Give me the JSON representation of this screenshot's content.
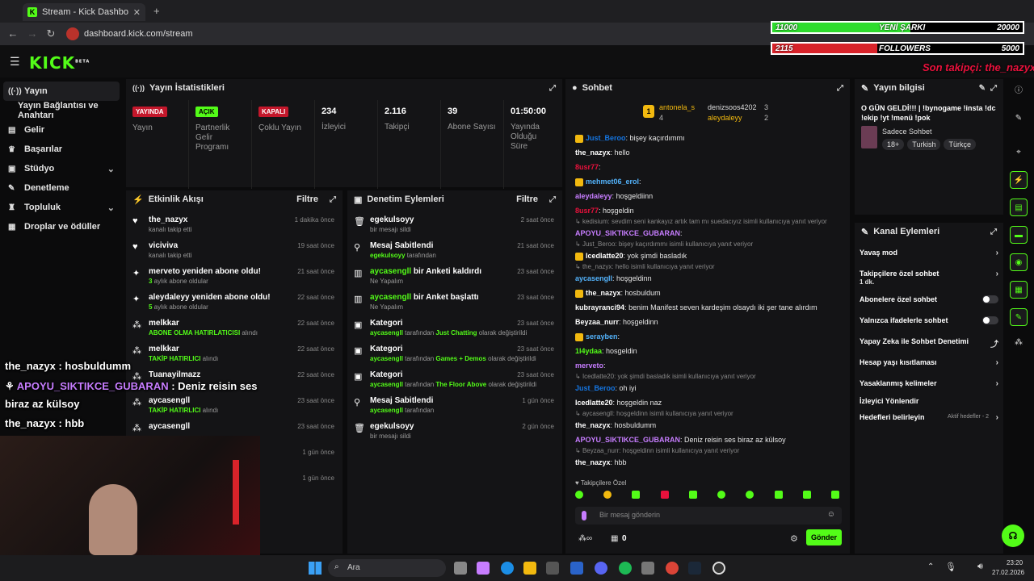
{
  "browser": {
    "tab_title": "Stream - Kick Dashboard",
    "url": "dashboard.kick.com/stream"
  },
  "app": {
    "logo": "KICK",
    "logo_sup": "BETA"
  },
  "sidebar": {
    "items": [
      {
        "label": "Yayın",
        "icon": "broadcast-icon"
      },
      {
        "label": "Yayın Bağlantısı ve Anahtarı",
        "icon": ""
      },
      {
        "label": "Gelir",
        "icon": "chart-icon"
      },
      {
        "label": "Başarılar",
        "icon": "trophy-icon"
      },
      {
        "label": "Stüdyo",
        "icon": "studio-icon"
      },
      {
        "label": "Denetleme",
        "icon": "wrench-icon"
      },
      {
        "label": "Topluluk",
        "icon": "community-icon"
      },
      {
        "label": "Droplar ve ödüller",
        "icon": "gift-icon"
      }
    ]
  },
  "stats": {
    "title": "Yayın İstatistikleri",
    "items": [
      {
        "badge": "YAYINDA",
        "label": "Yayın"
      },
      {
        "badge": "AÇIK",
        "label": "Partnerlik Gelir Programı"
      },
      {
        "badge": "KAPALI",
        "label": "Çoklu Yayın"
      },
      {
        "value": "234",
        "label": "İzleyici"
      },
      {
        "value": "2.116",
        "label": "Takipçi"
      },
      {
        "value": "39",
        "label": "Abone Sayısı"
      },
      {
        "value": "01:50:00",
        "label": "Yayında Olduğu Süre"
      }
    ]
  },
  "activity": {
    "title": "Etkinlik Akışı",
    "filter": "Filtre",
    "rows": [
      {
        "name": "the_nazyx",
        "sub": "kanalı takip etti",
        "time": "1 dakika önce",
        "icon": "heart-icon"
      },
      {
        "name": "viciviva",
        "sub": "kanalı takip etti",
        "time": "19 saat önce",
        "icon": "heart-icon"
      },
      {
        "name": "merveto yeniden abone oldu!",
        "subhl": "3",
        "sub": " aylık abone oldular",
        "time": "21 saat önce",
        "icon": "sparkle-icon"
      },
      {
        "name": "aleydaleyy yeniden abone oldu!",
        "subhl": "5",
        "sub": " aylık abone oldular",
        "time": "22 saat önce",
        "icon": "sparkle-icon"
      },
      {
        "name": "melkkar",
        "subhl": "ABONE OLMA HATIRLATICISI",
        "sub": " alındı",
        "time": "22 saat önce",
        "icon": "drop-icon"
      },
      {
        "name": "melkkar",
        "subhl": "TAKİP HATIRLICI",
        "sub": " alındı",
        "time": "22 saat önce",
        "icon": "drop-icon"
      },
      {
        "name": "Tuanayilmazz",
        "subhl": "",
        "sub": "",
        "time": "22 saat önce",
        "icon": "drop-icon"
      },
      {
        "name": "aycasengll",
        "subhl": "TAKİP HATIRLICI",
        "sub": " alındı",
        "time": "23 saat önce",
        "icon": "drop-icon"
      },
      {
        "name": "aycasengll",
        "subhl": "",
        "sub": "",
        "time": "23 saat önce",
        "icon": "drop-icon"
      },
      {
        "name": "",
        "subhl": "",
        "sub": "",
        "time": "1 gün önce",
        "icon": ""
      },
      {
        "name": "",
        "subhl": "",
        "sub": "",
        "time": "1 gün önce",
        "icon": ""
      }
    ]
  },
  "moderation": {
    "title": "Denetim Eylemleri",
    "filter": "Filtre",
    "rows": [
      {
        "name": "egekulsoyy",
        "sub": "bir mesajı sildi",
        "time": "2 saat önce",
        "icon": "trash-icon"
      },
      {
        "name": "Mesaj Sabitlendi",
        "subhl": "egekulsoyy",
        "sub": " tarafından",
        "time": "21 saat önce",
        "icon": "pin-icon"
      },
      {
        "namehl": "aycasengll",
        "name": " bir Anketi kaldırdı",
        "sub": "Ne Yapalım",
        "time": "23 saat önce",
        "icon": "poll-icon"
      },
      {
        "namehl": "aycasengll",
        "name": " bir Anket başlattı",
        "sub": "Ne Yapalım",
        "time": "23 saat önce",
        "icon": "poll-icon"
      },
      {
        "name": "Kategori",
        "subhl": "aycasengll",
        "sub": " tarafından ",
        "subhl2": "Just Chatting",
        "sub2": " olarak değiştirildi",
        "time": "23 saat önce",
        "icon": "category-icon"
      },
      {
        "name": "Kategori",
        "subhl": "aycasengll",
        "sub": " tarafından ",
        "subhl2": "Games + Demos",
        "sub2": " olarak değiştirildi",
        "time": "23 saat önce",
        "icon": "category-icon"
      },
      {
        "name": "Kategori",
        "subhl": "aycasengll",
        "sub": " tarafından ",
        "subhl2": "The Floor Above",
        "sub2": " olarak değiştirildi",
        "time": "23 saat önce",
        "icon": "category-icon"
      },
      {
        "name": "Mesaj Sabitlendi",
        "subhl": "aycasengll",
        "sub": " tarafından",
        "time": "1 gün önce",
        "icon": "pin-icon"
      },
      {
        "name": "egekulsoyy",
        "sub": "bir mesajı sildi",
        "time": "2 gün önce",
        "icon": "trash-icon"
      }
    ]
  },
  "chat": {
    "title": "Sohbet",
    "top_gifters": [
      {
        "name": "antonela_s",
        "count": "4"
      },
      {
        "name": "denizsoos4202",
        "count": "3"
      },
      {
        "name": "aleydaleyy",
        "count": "2"
      }
    ],
    "lines": [
      {
        "user": "Just_Beroo",
        "text": "bişey kaçırdımmı",
        "color": "#1475e1",
        "sys": false
      },
      {
        "user": "the_nazyx",
        "text": "hello",
        "color": "#ffffff",
        "sys": false
      },
      {
        "user": "8usr77",
        "text": "",
        "color": "#e9113c",
        "sys": false
      },
      {
        "user": "mehmet06_erol",
        "text": "",
        "color": "#53b3fc",
        "sys": false
      },
      {
        "user": "aleydaleyy",
        "text": "hoşgeldiinn",
        "color": "#c77dff",
        "sys": false
      },
      {
        "user": "8usr77",
        "text": "hoşgeldin",
        "color": "#e9113c",
        "sys": false
      },
      {
        "user": "",
        "text": "kedisium: sevdim seni kankayız artık tam mı suedacıyız isimli kullanıcıya yanıt veriyor",
        "color": "",
        "sys": true
      },
      {
        "user": "APOYU_SIKTIKCE_GUBARAN",
        "text": "",
        "color": "#c77dff",
        "sys": false
      },
      {
        "user": "",
        "text": "Just_Beroo: bişey kaçırdımmı isimli kullanıcıya yanıt veriyor",
        "color": "",
        "sys": true
      },
      {
        "user": "Icedlatte20",
        "text": "yok şimdi basladık",
        "color": "#ffffff",
        "sys": false
      },
      {
        "user": "",
        "text": "the_nazyx: hello isimli kullanıcıya yanıt veriyor",
        "color": "",
        "sys": true
      },
      {
        "user": "aycasengll",
        "text": "hoşgeldinn",
        "color": "#53b3fc",
        "sys": false
      },
      {
        "user": "the_nazyx",
        "text": "hosbuldum",
        "color": "#ffffff",
        "sys": false
      },
      {
        "user": "kubrayranci94",
        "text": "benim Manifest seven kardeşim olsaydı iki şer tane alırdım",
        "color": "#ffffff",
        "sys": false
      },
      {
        "user": "Beyzaa_nurr",
        "text": "hoşgeldinn",
        "color": "#ffffff",
        "sys": false
      },
      {
        "user": "serayben",
        "text": "",
        "color": "#53b3fc",
        "sys": false
      },
      {
        "user": "1l4ydaa",
        "text": "hosgeldin",
        "color": "#53fc18",
        "sys": false
      },
      {
        "user": "merveto",
        "text": "",
        "color": "#c77dff",
        "sys": false
      },
      {
        "user": "",
        "text": "Icedlatte20: yok şimdi basladık isimli kullanıcıya yanıt veriyor",
        "color": "",
        "sys": true
      },
      {
        "user": "Just_Beroo",
        "text": "oh iyi",
        "color": "#1475e1",
        "sys": false
      },
      {
        "user": "Icedlatte20",
        "text": "hoşgeldin naz",
        "color": "#ffffff",
        "sys": false
      },
      {
        "user": "",
        "text": "aycasengll: hoşgeldinn isimli kullanıcıya yanıt veriyor",
        "color": "",
        "sys": true
      },
      {
        "user": "the_nazyx",
        "text": "hosbuldumm",
        "color": "#ffffff",
        "sys": false
      },
      {
        "user": "APOYU_SIKTIKCE_GUBARAN",
        "text": "Deniz reisin ses biraz az külsoy",
        "color": "#c77dff",
        "sys": false
      },
      {
        "user": "",
        "text": "Beyzaa_nurr: hoşgeldinn isimli kullanıcıya yanıt veriyor",
        "color": "",
        "sys": true
      },
      {
        "user": "the_nazyx",
        "text": "hbb",
        "color": "#ffffff",
        "sys": false
      }
    ],
    "subs_only_label": "Takipçilere Özel",
    "input_placeholder": "Bir mesaj gönderin",
    "points": "0",
    "send_label": "Gönder"
  },
  "stream_info": {
    "title": "Yayın bilgisi",
    "text": "O GÜN GELDİ!!! | !bynogame !insta !dc !ekip !yt !menü !pok",
    "category": "Sadece Sohbet",
    "tags": [
      "18+",
      "Turkish",
      "Türkçe"
    ]
  },
  "channel_actions": {
    "title": "Kanal Eylemleri",
    "rows": [
      {
        "label": "Yavaş mod",
        "type": "chevron"
      },
      {
        "label": "Takipçilere özel sohbet",
        "sub": "1 dk.",
        "type": "chevron"
      },
      {
        "label": "Abonelere özel sohbet",
        "type": "toggle"
      },
      {
        "label": "Yalnızca ifadelerle sohbet",
        "type": "toggle"
      },
      {
        "label": "Yapay Zeka ile Sohbet Denetimi",
        "type": "external"
      },
      {
        "label": "Hesap yaşı kısıtlaması",
        "type": "chevron"
      },
      {
        "label": "Yasaklanmış kelimeler",
        "type": "chevron"
      },
      {
        "label": "İzleyici Yönlendir",
        "type": "none"
      },
      {
        "label": "Hedefleri belirleyin",
        "extra": "Aktif hedefler - 2",
        "type": "chevron"
      }
    ]
  },
  "overlay": {
    "bar1": {
      "left": "11000",
      "mid": "YENİ ŞARKI",
      "right": "20000",
      "fill_fraction": 0.55,
      "color": "#2ddc2d"
    },
    "bar2": {
      "left": "2115",
      "mid": "FOLLOWERS",
      "right": "5000",
      "fill_fraction": 0.42,
      "color": "#d8232a"
    },
    "last_follower": "Son takipçi: the_nazyx",
    "chat": [
      {
        "user": "the_nazyx",
        "text": " : hosbuldumm"
      },
      {
        "user": "APOYU_SIKTIKCE_GUBARAN",
        "text": " : Deniz reisin ses"
      },
      {
        "user": "",
        "text": "biraz az külsoy"
      },
      {
        "user": "the_nazyx",
        "text": " : hbb"
      }
    ]
  },
  "taskbar": {
    "search": "Ara",
    "time": "23:20",
    "date": "27.02.2026"
  }
}
